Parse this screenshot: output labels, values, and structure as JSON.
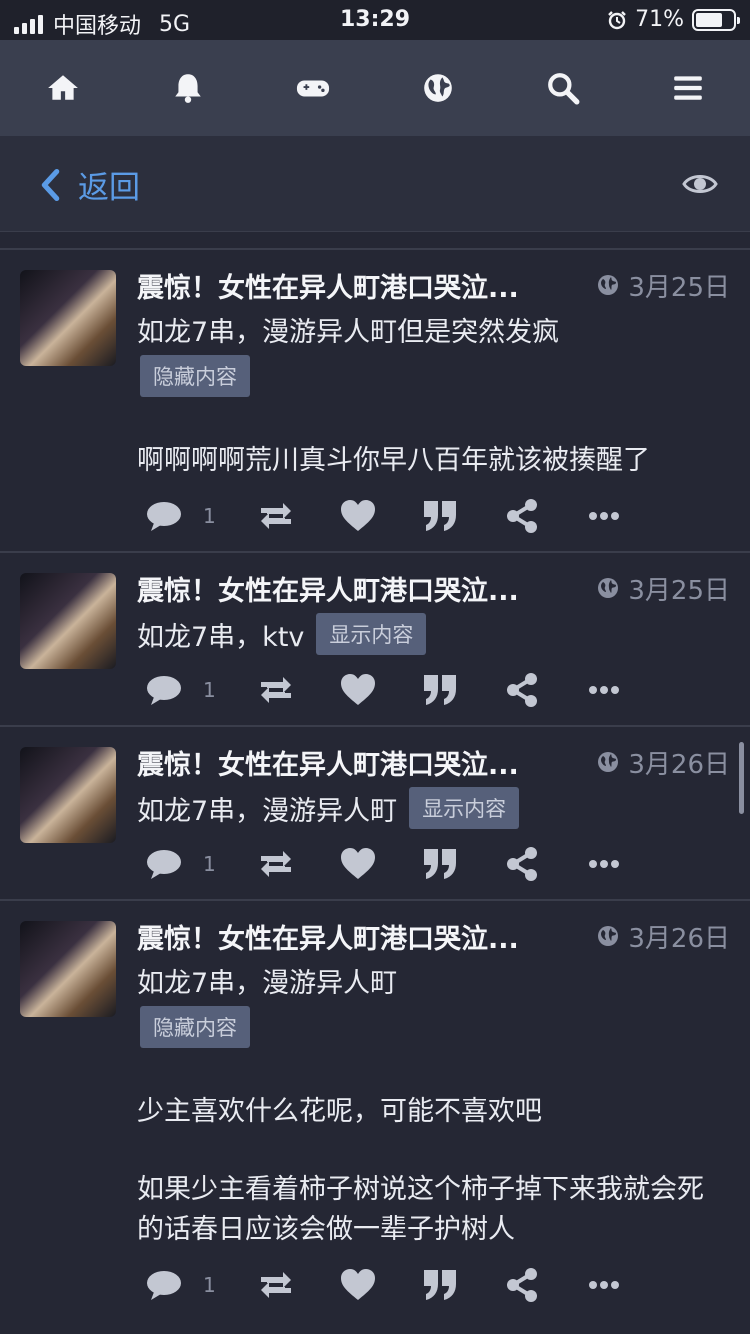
{
  "status": {
    "carrier": "中国移动",
    "network": "5G",
    "time": "13:29",
    "battery_text": "71%",
    "battery_level": 0.71,
    "alarm_icon": "alarm-clock-icon"
  },
  "topnav": {
    "icons": [
      "home-icon",
      "bell-icon",
      "gamepad-icon",
      "globe-icon",
      "search-icon",
      "menu-icon"
    ]
  },
  "subnav": {
    "back_label": "返回",
    "eye_icon": "eye-icon"
  },
  "colors": {
    "accent": "#5b9be6",
    "background": "#252734",
    "nav": "#3a3f4f",
    "tag": "#56607a"
  },
  "posts": [
    {
      "title": "震惊！女性在异人町港口哭泣...",
      "date": "3月25日",
      "line": "如龙7串，漫游异人町但是突然发疯",
      "tag": "隐藏内容",
      "content": [
        "啊啊啊啊荒川真斗你早八百年就该被揍醒了"
      ],
      "comment_count": "1"
    },
    {
      "title": "震惊！女性在异人町港口哭泣...",
      "date": "3月25日",
      "line": "如龙7串，ktv",
      "tag": "显示内容",
      "content": [],
      "comment_count": "1"
    },
    {
      "title": "震惊！女性在异人町港口哭泣...",
      "date": "3月26日",
      "line": "如龙7串，漫游异人町",
      "tag": "显示内容",
      "content": [],
      "comment_count": "1"
    },
    {
      "title": "震惊！女性在异人町港口哭泣...",
      "date": "3月26日",
      "line": "如龙7串，漫游异人町",
      "tag": "隐藏内容",
      "content": [
        "少主喜欢什么花呢，可能不喜欢吧",
        "如果少主看着柿子树说这个柿子掉下来我就会死的话春日应该会做一辈子护树人"
      ],
      "comment_count": "1"
    }
  ]
}
